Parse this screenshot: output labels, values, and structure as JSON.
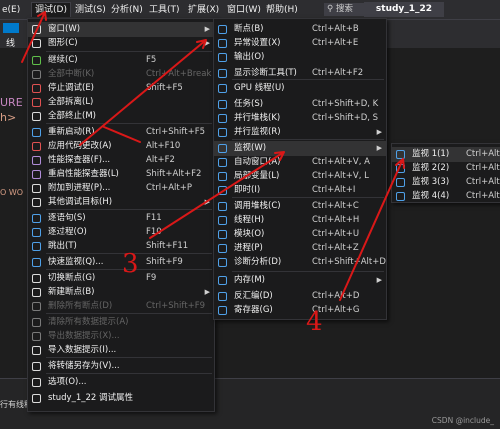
{
  "menubar": {
    "items": [
      "e(E)",
      "调试(D)",
      "测试(S)",
      "分析(N)",
      "工具(T)",
      "扩展(X)",
      "窗口(W)",
      "帮助(H)"
    ],
    "search": "搜索",
    "solution": "study_1_22"
  },
  "editor": {
    "frag1": "URE",
    "frag2": "h>",
    "frag3": "O WO",
    "tab_hint": "线"
  },
  "output": {
    "frag": "行有线程"
  },
  "debug_menu": {
    "items": [
      {
        "label": "窗口(W)",
        "arrow": true
      },
      {
        "label": "图形(C)",
        "arrow": true
      },
      {
        "label": "继续(C)",
        "sc": "F5"
      },
      {
        "label": "全部中断(K)",
        "sc": "Ctrl+Alt+Break",
        "disabled": true
      },
      {
        "label": "停止调试(E)",
        "sc": "Shift+F5"
      },
      {
        "label": "全部拆离(L)"
      },
      {
        "label": "全部终止(M)"
      },
      {
        "label": "重新启动(R)",
        "sc": "Ctrl+Shift+F5"
      },
      {
        "label": "应用代码更改(A)",
        "sc": "Alt+F10"
      },
      {
        "label": "性能探查器(F)...",
        "sc": "Alt+F2"
      },
      {
        "label": "重启性能探查器(L)",
        "sc": "Shift+Alt+F2"
      },
      {
        "label": "附加到进程(P)...",
        "sc": "Ctrl+Alt+P"
      },
      {
        "label": "其他调试目标(H)",
        "arrow": true
      },
      {
        "label": "逐语句(S)",
        "sc": "F11"
      },
      {
        "label": "逐过程(O)",
        "sc": "F10"
      },
      {
        "label": "跳出(T)",
        "sc": "Shift+F11"
      },
      {
        "label": "快速监视(Q)...",
        "sc": "Shift+F9"
      },
      {
        "label": "切换断点(G)",
        "sc": "F9"
      },
      {
        "label": "新建断点(B)",
        "arrow": true
      },
      {
        "label": "删除所有断点(D)",
        "sc": "Ctrl+Shift+F9",
        "disabled": true
      },
      {
        "label": "清除所有数据提示(A)",
        "disabled": true
      },
      {
        "label": "导出数据提示(X)...",
        "disabled": true
      },
      {
        "label": "导入数据提示(I)..."
      },
      {
        "label": "将转储另存为(V)..."
      },
      {
        "label": "选项(O)..."
      },
      {
        "label": "study_1_22 调试属性"
      }
    ]
  },
  "window_menu": {
    "items": [
      {
        "label": "断点(B)",
        "sc": "Ctrl+Alt+B"
      },
      {
        "label": "异常设置(X)",
        "sc": "Ctrl+Alt+E"
      },
      {
        "label": "输出(O)"
      },
      {
        "label": "显示诊断工具(T)",
        "sc": "Ctrl+Alt+F2"
      },
      {
        "label": "GPU 线程(U)"
      },
      {
        "label": "任务(S)",
        "sc": "Ctrl+Shift+D, K"
      },
      {
        "label": "并行堆栈(K)",
        "sc": "Ctrl+Shift+D, S"
      },
      {
        "label": "并行监视(R)",
        "arrow": true
      },
      {
        "label": "监视(W)",
        "arrow": true
      },
      {
        "label": "自动窗口(A)",
        "sc": "Ctrl+Alt+V, A"
      },
      {
        "label": "局部变量(L)",
        "sc": "Ctrl+Alt+V, L"
      },
      {
        "label": "即时(I)",
        "sc": "Ctrl+Alt+I"
      },
      {
        "label": "调用堆栈(C)",
        "sc": "Ctrl+Alt+C"
      },
      {
        "label": "线程(H)",
        "sc": "Ctrl+Alt+H"
      },
      {
        "label": "模块(O)",
        "sc": "Ctrl+Alt+U"
      },
      {
        "label": "进程(P)",
        "sc": "Ctrl+Alt+Z"
      },
      {
        "label": "诊断分析(D)",
        "sc": "Ctrl+Shift+Alt+D"
      },
      {
        "label": "内存(M)",
        "arrow": true
      },
      {
        "label": "反汇编(D)",
        "sc": "Ctrl+Alt+D"
      },
      {
        "label": "寄存器(G)",
        "sc": "Ctrl+Alt+G"
      }
    ]
  },
  "watch_menu": {
    "items": [
      {
        "label": "监视 1(1)",
        "sc": "Ctrl+Alt"
      },
      {
        "label": "监视 2(2)",
        "sc": "Ctrl+Alt"
      },
      {
        "label": "监视 3(3)",
        "sc": "Ctrl+Alt"
      },
      {
        "label": "监视 4(4)",
        "sc": "Ctrl+Alt"
      }
    ]
  },
  "annotations": {
    "n3": "3",
    "n4": "4"
  },
  "watermark": "CSDN @include_",
  "colors": {
    "accent": "#007acc",
    "arrow": "#d91818",
    "menu_bg": "#1b1b1c",
    "highlight": "#333334"
  }
}
